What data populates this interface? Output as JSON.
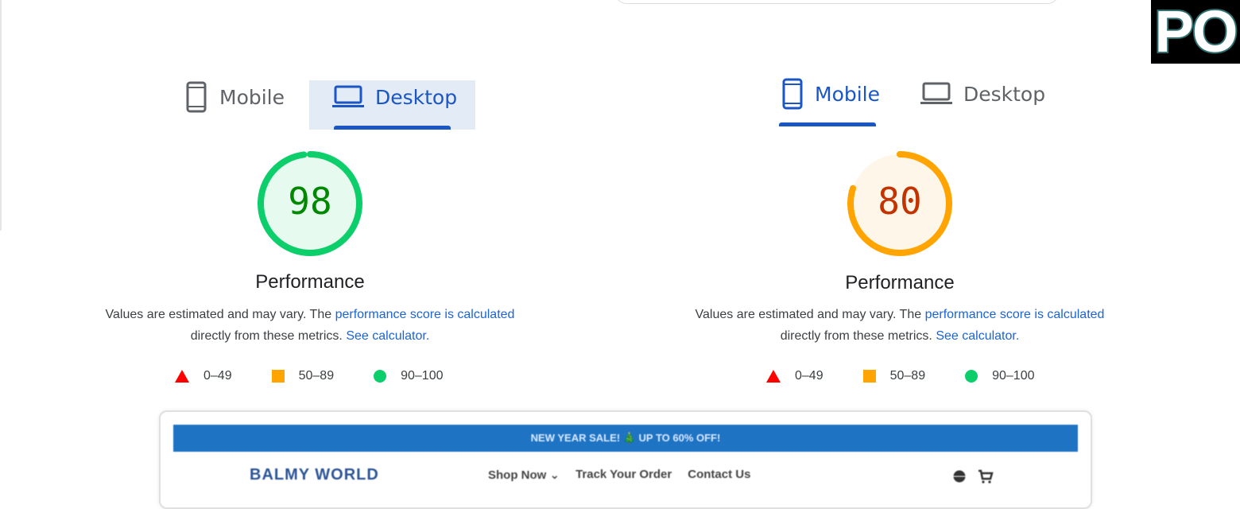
{
  "badge": {
    "text": "PO"
  },
  "left_report": {
    "tabs": [
      {
        "label": "Mobile",
        "icon": "phone-icon",
        "active": false
      },
      {
        "label": "Desktop",
        "icon": "laptop-icon",
        "active": true
      }
    ],
    "score": "98",
    "score_value": 98,
    "score_color": "#0cce6b",
    "score_text_color": "#008800",
    "title": "Performance",
    "desc_prefix": "Values are estimated and may vary. The ",
    "desc_link1": "performance score is calculated",
    "desc_middle": "directly from these metrics.",
    "desc_link2": "See calculator."
  },
  "right_report": {
    "tabs": [
      {
        "label": "Mobile",
        "icon": "phone-icon",
        "active": true
      },
      {
        "label": "Desktop",
        "icon": "laptop-icon",
        "active": false
      }
    ],
    "score": "80",
    "score_value": 80,
    "score_color": "#ffa400",
    "score_text_color": "#c33300",
    "title": "Performance",
    "desc_prefix": "Values are estimated and may vary. The ",
    "desc_link1": "performance score is calculated",
    "desc_middle": "directly from these metrics.",
    "desc_link2": "See calculator."
  },
  "legend": [
    {
      "range": "0–49",
      "shape": "triangle",
      "color": "#ff0000"
    },
    {
      "range": "50–89",
      "shape": "square",
      "color": "#ffa400"
    },
    {
      "range": "90–100",
      "shape": "circle",
      "color": "#0cce6b"
    }
  ],
  "preview": {
    "promo": "NEW YEAR SALE! 🎄 UP TO 60% OFF!",
    "logo": "BALMY WORLD",
    "nav": [
      "Shop Now ⌄",
      "Track Your Order",
      "Contact Us"
    ]
  }
}
